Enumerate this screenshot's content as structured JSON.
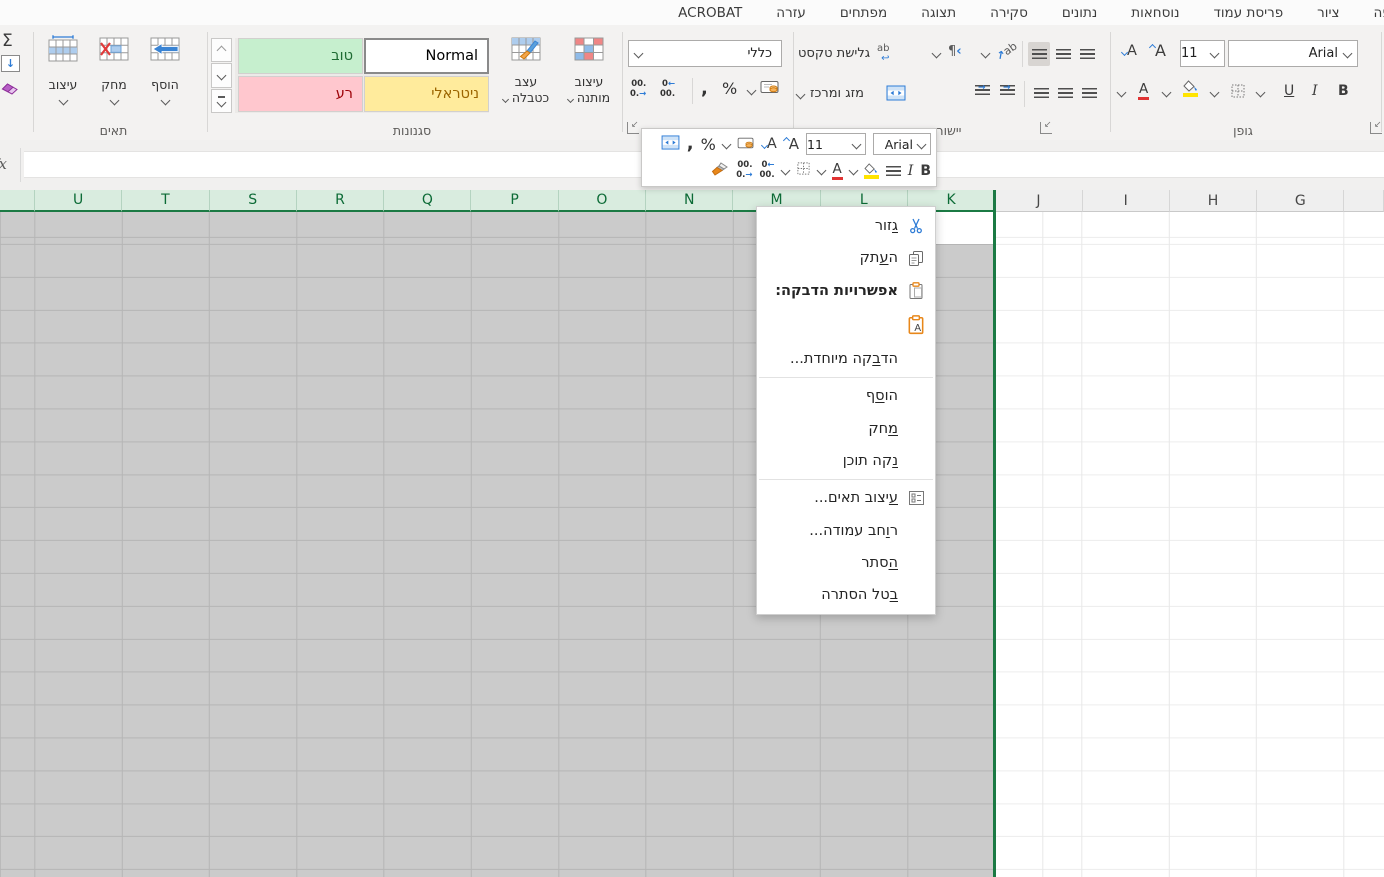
{
  "tabs": {
    "items": [
      {
        "label": "הוספה"
      },
      {
        "label": "ציור"
      },
      {
        "label": "פריסת עמוד"
      },
      {
        "label": "נוסחאות"
      },
      {
        "label": "נתונים"
      },
      {
        "label": "סקירה"
      },
      {
        "label": "תצוגה"
      },
      {
        "label": "מפתחים"
      },
      {
        "label": "עזרה"
      },
      {
        "label": "ACROBAT"
      }
    ]
  },
  "ribbon": {
    "cells": {
      "group_label": "תאים",
      "insert_label": "הוסף",
      "delete_label": "מחק",
      "format_label": "עיצוב"
    },
    "styles": {
      "group_label": "סגנונות",
      "normal_label": "Normal",
      "good_label": "טוב",
      "neutral_label": "ניטראלי",
      "bad_label": "רע",
      "format_as_table_line1": "עצב",
      "format_as_table_line2": "כטבלה",
      "conditional_line1": "עיצוב",
      "conditional_line2": "מותנה"
    },
    "number": {
      "format_value": "כללי"
    },
    "alignment": {
      "group_label": "יישור",
      "wrap_label": "גלישת טקסט",
      "merge_label": "מזג ומרכז"
    },
    "font": {
      "group_label": "גופן",
      "font_name": "Arial",
      "font_size": "11",
      "bold": "B",
      "italic": "I",
      "underline": "U"
    }
  },
  "mini_toolbar": {
    "font_name": "Arial",
    "font_size": "11",
    "bold": "B",
    "italic": "I"
  },
  "formula_bar": {
    "fx_label": "fx",
    "value": ""
  },
  "sheet": {
    "selected_columns": "K:U",
    "headers": [
      {
        "label": ""
      },
      {
        "label": "U"
      },
      {
        "label": "T"
      },
      {
        "label": "S"
      },
      {
        "label": "R"
      },
      {
        "label": "Q"
      },
      {
        "label": "P"
      },
      {
        "label": "O"
      },
      {
        "label": "N"
      },
      {
        "label": "M"
      },
      {
        "label": "L"
      },
      {
        "label": "K"
      },
      {
        "label": "J"
      },
      {
        "label": "I"
      },
      {
        "label": "H"
      },
      {
        "label": "G"
      },
      {
        "label": ""
      }
    ]
  },
  "context_menu": {
    "items": [
      {
        "name": "cut",
        "pre": "",
        "key": "ג",
        "post": "זור"
      },
      {
        "name": "copy",
        "pre": "ה",
        "key": "ע",
        "post": "תק"
      },
      {
        "name": "paste-options",
        "label": "אפשרויות הדבקה:"
      },
      {
        "name": "paste-values-option",
        "label": ""
      },
      {
        "name": "paste-special",
        "pre": "הד",
        "key": "ב",
        "post": "קה מיוחדת..."
      },
      {
        "name": "insert",
        "pre": "הו",
        "key": "ס",
        "post": "ף"
      },
      {
        "name": "delete",
        "pre": "",
        "key": "מ",
        "post": "חק"
      },
      {
        "name": "clear-contents",
        "pre": "",
        "key": "נ",
        "post": "קה תוכן"
      },
      {
        "name": "format-cells",
        "pre": "",
        "key": "ע",
        "post": "יצוב תאים..."
      },
      {
        "name": "column-width",
        "pre": "ר",
        "key": "ו",
        "post": "חב עמודה..."
      },
      {
        "name": "hide",
        "pre": "",
        "key": "ה",
        "post": "סתר"
      },
      {
        "name": "unhide",
        "pre": "",
        "key": "ב",
        "post": "טל הסתרה"
      }
    ]
  },
  "colors": {
    "selection_border_green": "#107c41",
    "selected_header_bg": "#d9ecdf",
    "selected_header_text": "#0c6b36",
    "selected_cells_gray": "#cbcbcb",
    "style_good_bg": "#c6efce",
    "style_good_text": "#1f6b33",
    "style_bad_bg": "#ffc7ce",
    "style_bad_text": "#9c0006",
    "style_neutral_bg": "#ffeb9c",
    "style_neutral_text": "#9c6500",
    "font_color_red": "#e03333",
    "highlight_yellow": "#ffe400",
    "accent_blue": "#2e7cd6",
    "accent_orange": "#e8871a"
  }
}
